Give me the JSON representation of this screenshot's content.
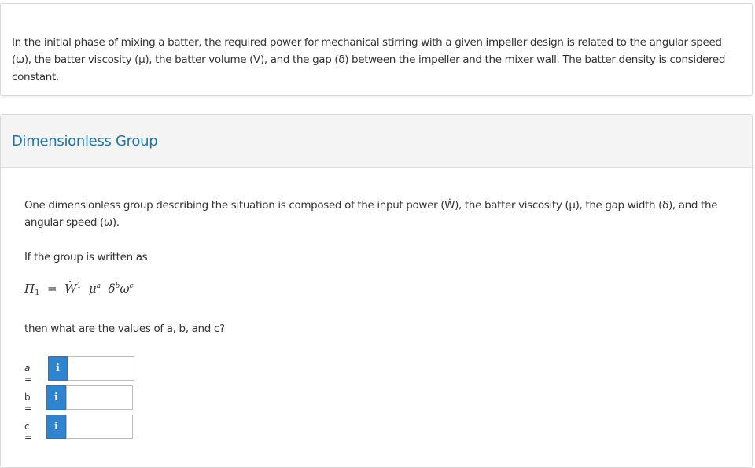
{
  "intro": {
    "text": "In the initial phase of mixing a batter, the required power for mechanical stirring with a given impeller design is related to the angular speed (ω), the batter viscosity (μ), the batter volume (V), and the gap (δ) between the impeller and the mixer wall. The batter density is considered constant."
  },
  "section": {
    "title": "Dimensionless Group",
    "question_text": "One dimensionless group describing the situation is composed of the input power (Ẇ), the batter viscosity (μ), the gap width (δ), and the angular speed (ω).",
    "group_intro": "If the group is written as",
    "equation": {
      "lhs": "Π",
      "lhs_sub": "1",
      "equals": "=",
      "w": "W",
      "w_exp": "1",
      "mu": "μ",
      "mu_exp": "a",
      "delta": "δ",
      "delta_exp": "b",
      "omega": "ω",
      "omega_exp": "c"
    },
    "question_prompt": "then what are the values of a, b, and c?"
  },
  "answers": [
    {
      "var": "a",
      "eq": " =",
      "info": "i",
      "value": ""
    },
    {
      "var": "b",
      "eq": " =",
      "info": "i",
      "value": ""
    },
    {
      "var": "c",
      "eq": " =",
      "info": "i",
      "value": ""
    }
  ],
  "colors": {
    "title": "#1f75a8",
    "info_button": "#2f84d0",
    "header_bg": "#f4f4f4"
  }
}
